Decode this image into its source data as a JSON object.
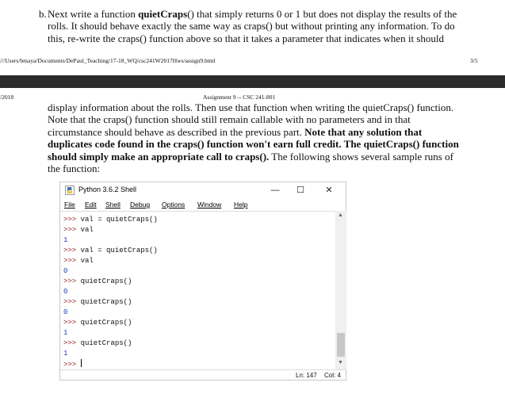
{
  "page1": {
    "item_label": "b.",
    "paragraph_html": "Next write a function <b>quietCraps</b>() that simply returns 0 or 1 but does not display the results of the rolls. It should behave exactly the same way as craps() but without printing any information. To do this, re-write the craps() function above so that it takes a parameter that indicates when it should",
    "footer_url": "///Users/bmaya/Documents/DePaul_Teaching/17-18_WQ/csc241W2017Hws/assign9.html",
    "footer_page": "3/5"
  },
  "page2": {
    "header_left": "/2018",
    "header_center": "Assignment 9 -- CSC 241-801",
    "paragraph_html": "display information about the rolls. Then use that function when writing the quietCraps() function. Note that the craps() function should still remain callable with no parameters and in that circumstance should behave as described in the previous part. <b>Note that any solution that duplicates code found in the craps() function won't earn full credit. The quietCraps() function should simply make an appropriate call to craps().</b> The following shows several sample runs of the function:"
  },
  "shell": {
    "title": "Python 3.6.2 Shell",
    "minimize_glyph": "—",
    "maximize_glyph": "☐",
    "close_glyph": "✕",
    "menu": [
      "File",
      "Edit",
      "Shell",
      "Debug",
      "Options",
      "Window",
      "Help"
    ],
    "lines": [
      {
        "prompt": ">>> ",
        "text": "val = quietCraps()",
        "kind": "code"
      },
      {
        "prompt": ">>> ",
        "text": "val",
        "kind": "code"
      },
      {
        "prompt": "",
        "text": "1",
        "kind": "out"
      },
      {
        "prompt": ">>> ",
        "text": "val = quietCraps()",
        "kind": "code"
      },
      {
        "prompt": ">>> ",
        "text": "val",
        "kind": "code"
      },
      {
        "prompt": "",
        "text": "0",
        "kind": "out"
      },
      {
        "prompt": ">>> ",
        "text": "quietCraps()",
        "kind": "code"
      },
      {
        "prompt": "",
        "text": "0",
        "kind": "out"
      },
      {
        "prompt": ">>> ",
        "text": "quietCraps()",
        "kind": "code"
      },
      {
        "prompt": "",
        "text": "0",
        "kind": "out"
      },
      {
        "prompt": ">>> ",
        "text": "quietCraps()",
        "kind": "code"
      },
      {
        "prompt": "",
        "text": "1",
        "kind": "out"
      },
      {
        "prompt": ">>> ",
        "text": "quietCraps()",
        "kind": "code"
      },
      {
        "prompt": "",
        "text": "1",
        "kind": "out"
      },
      {
        "prompt": ">>> ",
        "text": "",
        "kind": "cursor"
      }
    ],
    "status_line": "Ln: 147",
    "status_col": "Col: 4",
    "scroll_up_glyph": "▲",
    "scroll_down_glyph": "▼"
  }
}
